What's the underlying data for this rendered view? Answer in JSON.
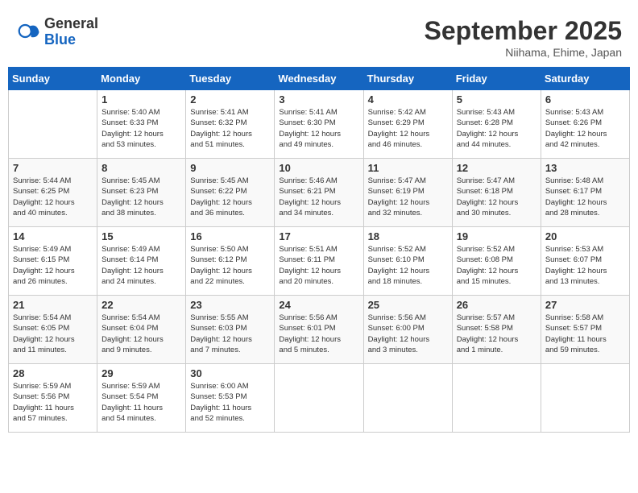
{
  "header": {
    "logo_general": "General",
    "logo_blue": "Blue",
    "month_title": "September 2025",
    "location": "Niihama, Ehime, Japan"
  },
  "weekdays": [
    "Sunday",
    "Monday",
    "Tuesday",
    "Wednesday",
    "Thursday",
    "Friday",
    "Saturday"
  ],
  "weeks": [
    [
      {
        "day": "",
        "info": ""
      },
      {
        "day": "1",
        "info": "Sunrise: 5:40 AM\nSunset: 6:33 PM\nDaylight: 12 hours\nand 53 minutes."
      },
      {
        "day": "2",
        "info": "Sunrise: 5:41 AM\nSunset: 6:32 PM\nDaylight: 12 hours\nand 51 minutes."
      },
      {
        "day": "3",
        "info": "Sunrise: 5:41 AM\nSunset: 6:30 PM\nDaylight: 12 hours\nand 49 minutes."
      },
      {
        "day": "4",
        "info": "Sunrise: 5:42 AM\nSunset: 6:29 PM\nDaylight: 12 hours\nand 46 minutes."
      },
      {
        "day": "5",
        "info": "Sunrise: 5:43 AM\nSunset: 6:28 PM\nDaylight: 12 hours\nand 44 minutes."
      },
      {
        "day": "6",
        "info": "Sunrise: 5:43 AM\nSunset: 6:26 PM\nDaylight: 12 hours\nand 42 minutes."
      }
    ],
    [
      {
        "day": "7",
        "info": "Sunrise: 5:44 AM\nSunset: 6:25 PM\nDaylight: 12 hours\nand 40 minutes."
      },
      {
        "day": "8",
        "info": "Sunrise: 5:45 AM\nSunset: 6:23 PM\nDaylight: 12 hours\nand 38 minutes."
      },
      {
        "day": "9",
        "info": "Sunrise: 5:45 AM\nSunset: 6:22 PM\nDaylight: 12 hours\nand 36 minutes."
      },
      {
        "day": "10",
        "info": "Sunrise: 5:46 AM\nSunset: 6:21 PM\nDaylight: 12 hours\nand 34 minutes."
      },
      {
        "day": "11",
        "info": "Sunrise: 5:47 AM\nSunset: 6:19 PM\nDaylight: 12 hours\nand 32 minutes."
      },
      {
        "day": "12",
        "info": "Sunrise: 5:47 AM\nSunset: 6:18 PM\nDaylight: 12 hours\nand 30 minutes."
      },
      {
        "day": "13",
        "info": "Sunrise: 5:48 AM\nSunset: 6:17 PM\nDaylight: 12 hours\nand 28 minutes."
      }
    ],
    [
      {
        "day": "14",
        "info": "Sunrise: 5:49 AM\nSunset: 6:15 PM\nDaylight: 12 hours\nand 26 minutes."
      },
      {
        "day": "15",
        "info": "Sunrise: 5:49 AM\nSunset: 6:14 PM\nDaylight: 12 hours\nand 24 minutes."
      },
      {
        "day": "16",
        "info": "Sunrise: 5:50 AM\nSunset: 6:12 PM\nDaylight: 12 hours\nand 22 minutes."
      },
      {
        "day": "17",
        "info": "Sunrise: 5:51 AM\nSunset: 6:11 PM\nDaylight: 12 hours\nand 20 minutes."
      },
      {
        "day": "18",
        "info": "Sunrise: 5:52 AM\nSunset: 6:10 PM\nDaylight: 12 hours\nand 18 minutes."
      },
      {
        "day": "19",
        "info": "Sunrise: 5:52 AM\nSunset: 6:08 PM\nDaylight: 12 hours\nand 15 minutes."
      },
      {
        "day": "20",
        "info": "Sunrise: 5:53 AM\nSunset: 6:07 PM\nDaylight: 12 hours\nand 13 minutes."
      }
    ],
    [
      {
        "day": "21",
        "info": "Sunrise: 5:54 AM\nSunset: 6:05 PM\nDaylight: 12 hours\nand 11 minutes."
      },
      {
        "day": "22",
        "info": "Sunrise: 5:54 AM\nSunset: 6:04 PM\nDaylight: 12 hours\nand 9 minutes."
      },
      {
        "day": "23",
        "info": "Sunrise: 5:55 AM\nSunset: 6:03 PM\nDaylight: 12 hours\nand 7 minutes."
      },
      {
        "day": "24",
        "info": "Sunrise: 5:56 AM\nSunset: 6:01 PM\nDaylight: 12 hours\nand 5 minutes."
      },
      {
        "day": "25",
        "info": "Sunrise: 5:56 AM\nSunset: 6:00 PM\nDaylight: 12 hours\nand 3 minutes."
      },
      {
        "day": "26",
        "info": "Sunrise: 5:57 AM\nSunset: 5:58 PM\nDaylight: 12 hours\nand 1 minute."
      },
      {
        "day": "27",
        "info": "Sunrise: 5:58 AM\nSunset: 5:57 PM\nDaylight: 11 hours\nand 59 minutes."
      }
    ],
    [
      {
        "day": "28",
        "info": "Sunrise: 5:59 AM\nSunset: 5:56 PM\nDaylight: 11 hours\nand 57 minutes."
      },
      {
        "day": "29",
        "info": "Sunrise: 5:59 AM\nSunset: 5:54 PM\nDaylight: 11 hours\nand 54 minutes."
      },
      {
        "day": "30",
        "info": "Sunrise: 6:00 AM\nSunset: 5:53 PM\nDaylight: 11 hours\nand 52 minutes."
      },
      {
        "day": "",
        "info": ""
      },
      {
        "day": "",
        "info": ""
      },
      {
        "day": "",
        "info": ""
      },
      {
        "day": "",
        "info": ""
      }
    ]
  ]
}
